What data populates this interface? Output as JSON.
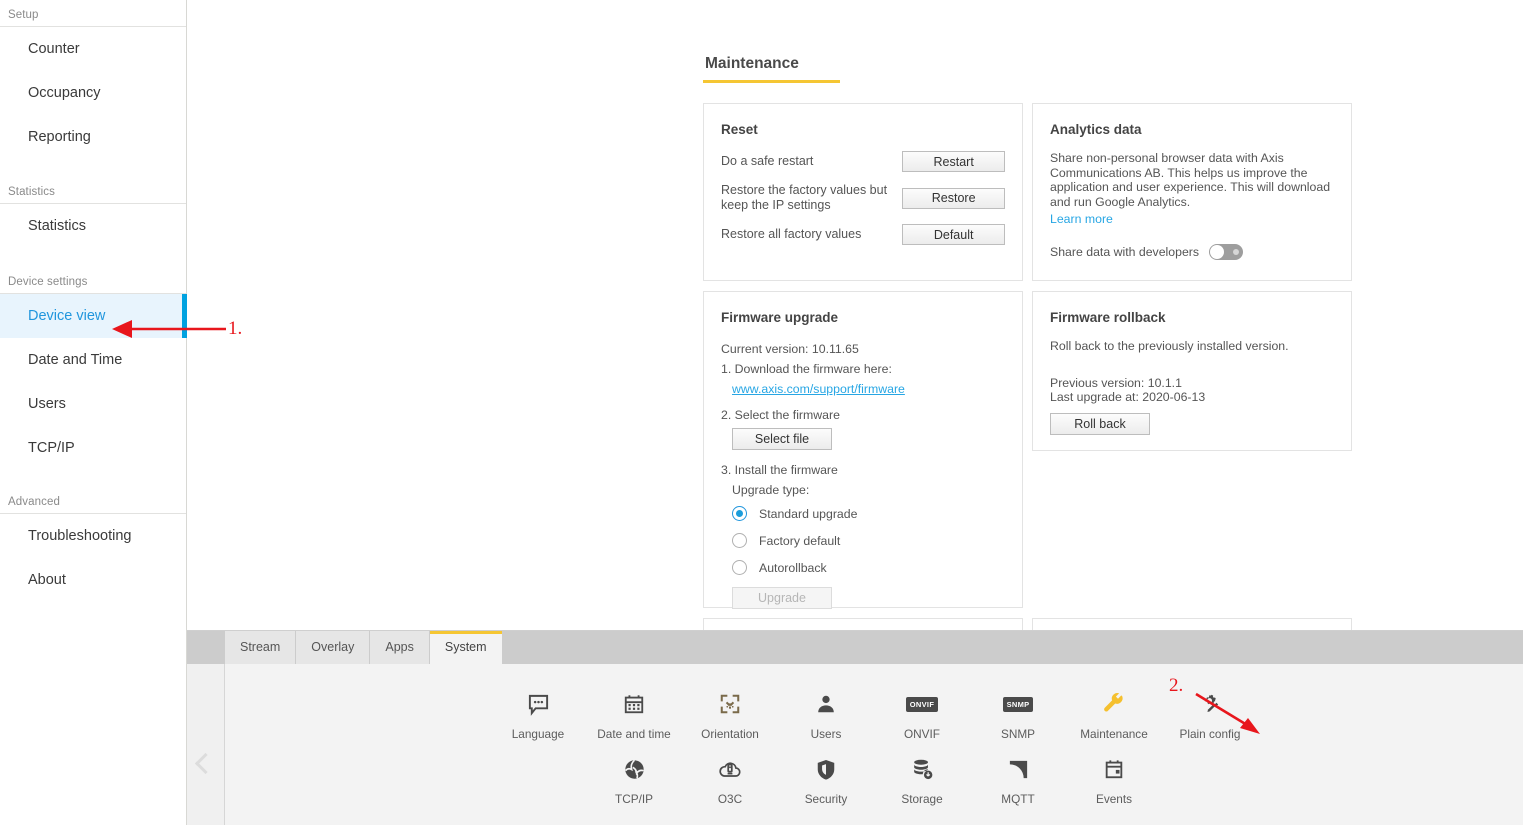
{
  "sidebar": {
    "groups": [
      {
        "label": "Setup",
        "items": [
          {
            "label": "Counter",
            "active": false
          },
          {
            "label": "Occupancy",
            "active": false
          },
          {
            "label": "Reporting",
            "active": false
          }
        ]
      },
      {
        "label": "Statistics",
        "items": [
          {
            "label": "Statistics",
            "active": false
          }
        ]
      },
      {
        "label": "Device settings",
        "items": [
          {
            "label": "Device view",
            "active": true
          },
          {
            "label": "Date and Time",
            "active": false
          },
          {
            "label": "Users",
            "active": false
          },
          {
            "label": "TCP/IP",
            "active": false
          }
        ]
      },
      {
        "label": "Advanced",
        "items": [
          {
            "label": "Troubleshooting",
            "active": false
          },
          {
            "label": "About",
            "active": false
          }
        ]
      }
    ]
  },
  "main": {
    "page_title": "Maintenance",
    "reset": {
      "title": "Reset",
      "rows": [
        {
          "label": "Do a safe restart",
          "button": "Restart"
        },
        {
          "label": "Restore the factory values but keep the IP settings",
          "button": "Restore"
        },
        {
          "label": "Restore all factory values",
          "button": "Default"
        }
      ]
    },
    "analytics": {
      "title": "Analytics data",
      "body": "Share non-personal browser data with Axis Communications AB. This helps us improve the application and user experience. This will download and run Google Analytics.",
      "learn_more": "Learn more",
      "toggle_label": "Share data with developers",
      "toggle_state": "off"
    },
    "firmware_upgrade": {
      "title": "Firmware upgrade",
      "current_version": "Current version: 10.11.65",
      "step1": "1. Download the firmware here:",
      "link": "www.axis.com/support/firmware",
      "step2": "2. Select the firmware",
      "select_file": "Select file",
      "step3": "3. Install the firmware",
      "upgrade_type_label": "Upgrade type:",
      "options": [
        {
          "label": "Standard upgrade",
          "selected": true
        },
        {
          "label": "Factory default",
          "selected": false
        },
        {
          "label": "Autorollback",
          "selected": false
        }
      ],
      "upgrade_button": "Upgrade",
      "upgrade_disabled": true
    },
    "firmware_rollback": {
      "title": "Firmware rollback",
      "body": "Roll back to the previously installed version.",
      "previous_version": "Previous version: 10.1.1",
      "last_upgrade": "Last upgrade at: 2020-06-13",
      "button": "Roll back"
    }
  },
  "annotations": [
    {
      "id": "1",
      "label": "1.",
      "color": "#e8161c"
    },
    {
      "id": "2",
      "label": "2.",
      "color": "#e8161c"
    }
  ],
  "bottom": {
    "tabs": [
      {
        "label": "Stream",
        "active": false
      },
      {
        "label": "Overlay",
        "active": false
      },
      {
        "label": "Apps",
        "active": false
      },
      {
        "label": "System",
        "active": true
      }
    ],
    "rows": [
      [
        {
          "label": "Language",
          "icon": "speech-bubble-icon",
          "highlight": false
        },
        {
          "label": "Date and time",
          "icon": "calendar-icon",
          "highlight": false
        },
        {
          "label": "Orientation",
          "icon": "crop-frame-icon",
          "highlight": false
        },
        {
          "label": "Users",
          "icon": "person-icon",
          "highlight": false
        },
        {
          "label": "ONVIF",
          "icon": "onvif-badge-icon",
          "badge": "ONVIF",
          "highlight": false
        },
        {
          "label": "SNMP",
          "icon": "snmp-badge-icon",
          "badge": "SNMP",
          "highlight": false
        },
        {
          "label": "Maintenance",
          "icon": "wrench-icon",
          "highlight": true
        },
        {
          "label": "Plain config",
          "icon": "gear-wand-icon",
          "highlight": false
        }
      ],
      [
        {
          "label": "TCP/IP",
          "icon": "globe-icon",
          "highlight": false
        },
        {
          "label": "O3C",
          "icon": "cloud-device-icon",
          "highlight": false
        },
        {
          "label": "Security",
          "icon": "shield-icon",
          "highlight": false
        },
        {
          "label": "Storage",
          "icon": "storage-download-icon",
          "highlight": false
        },
        {
          "label": "MQTT",
          "icon": "mqtt-waves-icon",
          "highlight": false
        },
        {
          "label": "Events",
          "icon": "events-calendar-icon",
          "highlight": false
        }
      ]
    ],
    "collapse_icon": "chevron-left-icon"
  },
  "colors": {
    "accent_yellow": "#f5c633",
    "accent_blue": "#00a2e0",
    "link_blue": "#27a6e4",
    "annotation_red": "#e8161c",
    "highlight_icon": "#f5c633"
  }
}
